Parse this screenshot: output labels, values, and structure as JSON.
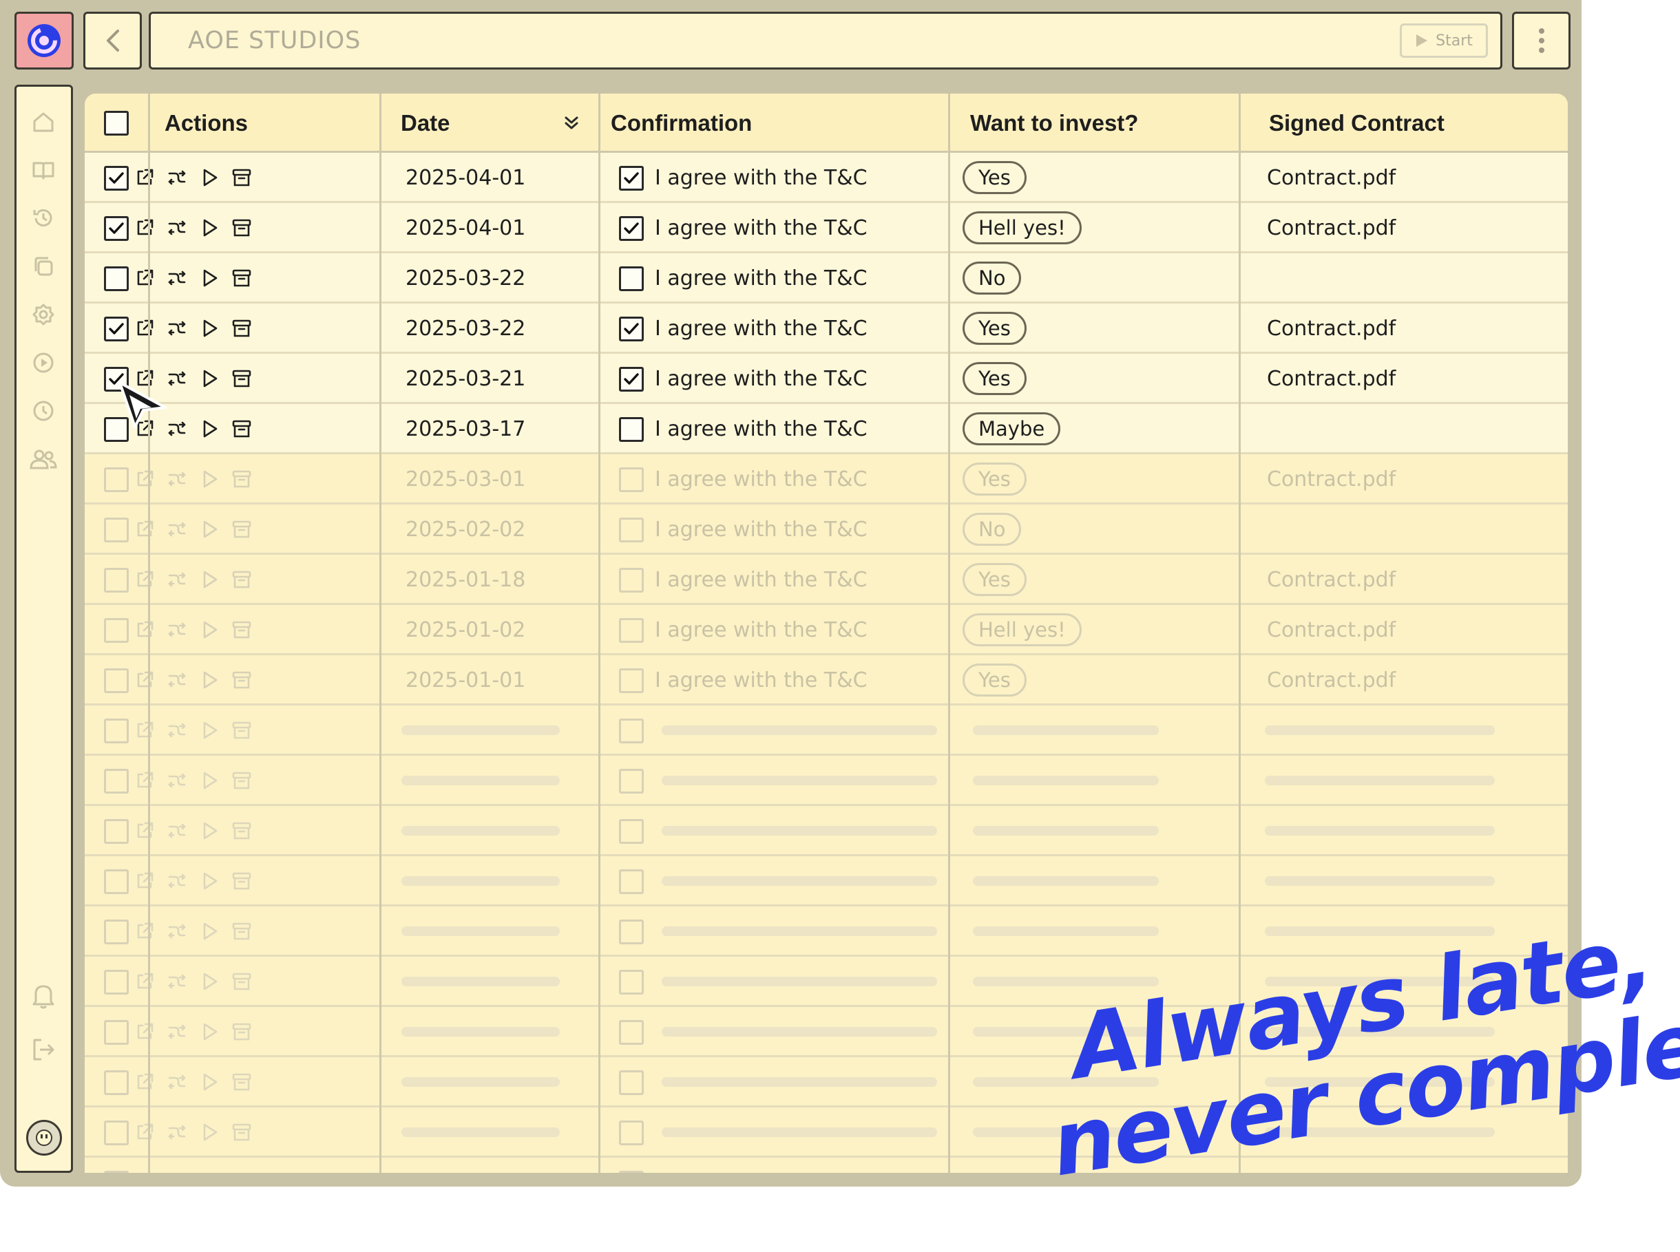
{
  "app": {
    "title": "AOE STUDIOS",
    "start_label": "Start"
  },
  "sidebar": {
    "items": [
      "home-icon",
      "book-icon",
      "history-icon",
      "copy-icon",
      "settings-icon",
      "play-circle-icon",
      "clock-icon",
      "users-icon"
    ],
    "bottom": [
      "bell-icon",
      "logout-icon"
    ]
  },
  "table": {
    "headers": {
      "actions": "Actions",
      "date": "Date",
      "confirmation": "Confirmation",
      "invest": "Want to invest?",
      "contract": "Signed Contract"
    },
    "rows": [
      {
        "selected": true,
        "date": "2025-04-01",
        "confirmed": true,
        "confirm_text": "I agree with the T&C",
        "invest": "Yes",
        "contract": "Contract.pdf",
        "state": "active"
      },
      {
        "selected": true,
        "date": "2025-04-01",
        "confirmed": true,
        "confirm_text": "I agree with the T&C",
        "invest": "Hell yes!",
        "contract": "Contract.pdf",
        "state": "active"
      },
      {
        "selected": false,
        "date": "2025-03-22",
        "confirmed": false,
        "confirm_text": "I agree with the T&C",
        "invest": "No",
        "contract": "",
        "state": "active"
      },
      {
        "selected": true,
        "date": "2025-03-22",
        "confirmed": true,
        "confirm_text": "I agree with the T&C",
        "invest": "Yes",
        "contract": "Contract.pdf",
        "state": "active"
      },
      {
        "selected": true,
        "date": "2025-03-21",
        "confirmed": true,
        "confirm_text": "I agree with the T&C",
        "invest": "Yes",
        "contract": "Contract.pdf",
        "state": "active"
      },
      {
        "selected": false,
        "date": "2025-03-17",
        "confirmed": false,
        "confirm_text": "I agree with the T&C",
        "invest": "Maybe",
        "contract": "",
        "state": "active"
      },
      {
        "selected": false,
        "date": "2025-03-01",
        "confirmed": false,
        "confirm_text": "I agree with the T&C",
        "invest": "Yes",
        "contract": "Contract.pdf",
        "state": "faded"
      },
      {
        "selected": false,
        "date": "2025-02-02",
        "confirmed": false,
        "confirm_text": "I agree with the T&C",
        "invest": "No",
        "contract": "",
        "state": "faded"
      },
      {
        "selected": false,
        "date": "2025-01-18",
        "confirmed": false,
        "confirm_text": "I agree with the T&C",
        "invest": "Yes",
        "contract": "Contract.pdf",
        "state": "faded"
      },
      {
        "selected": false,
        "date": "2025-01-02",
        "confirmed": false,
        "confirm_text": "I agree with the T&C",
        "invest": "Hell yes!",
        "contract": "Contract.pdf",
        "state": "faded"
      },
      {
        "selected": false,
        "date": "2025-01-01",
        "confirmed": false,
        "confirm_text": "I agree with the T&C",
        "invest": "Yes",
        "contract": "Contract.pdf",
        "state": "faded"
      }
    ],
    "skeleton_rows": 10
  },
  "tagline": {
    "line1": "Always late,",
    "line2": "never complete"
  },
  "colors": {
    "accent": "#2b3ee6",
    "frame": "#c8c3a6",
    "panel": "#fcf2c6",
    "logo_bg": "#f2a3a3"
  }
}
